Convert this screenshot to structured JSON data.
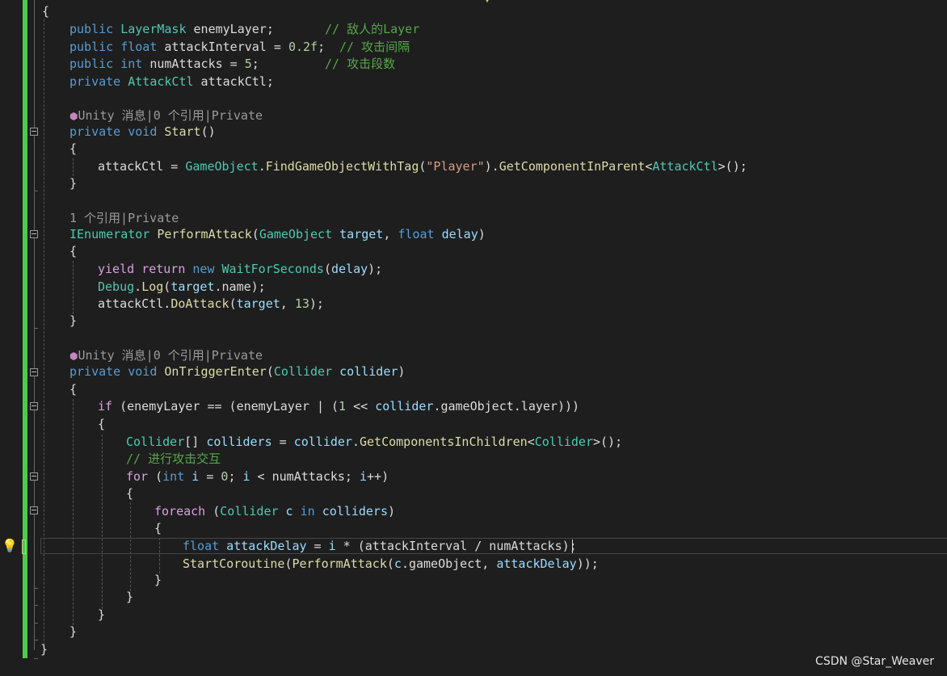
{
  "codelens": {
    "start": "Unity 消息|0 个引用|Private",
    "perform_attack": "1 个引用|Private",
    "on_trigger_enter": "Unity 消息|0 个引用|Private"
  },
  "code": {
    "open_class": "{",
    "f1": {
      "a": "public",
      "t": "LayerMask",
      "n": " enemyLayer;",
      "c": "// 敌人的Layer"
    },
    "f2": {
      "a": "public",
      "t": "float",
      "n": " attackInterval = ",
      "v": "0.2f",
      "e": ";",
      "c": "// 攻击间隔"
    },
    "f3": {
      "a": "public",
      "t": "int",
      "n": " numAttacks = ",
      "v": "5",
      "e": ";",
      "c": "// 攻击段数"
    },
    "f4": {
      "a": "private",
      "t": "AttackCtl",
      "n": " attackCtl;"
    },
    "start_sig": {
      "a": "private",
      "b": "void",
      "f": "Start",
      "p": "()"
    },
    "start_body": {
      "a": "attackCtl = ",
      "t": "GameObject",
      "d": ".",
      "f": "FindGameObjectWithTag",
      "o": "(",
      "s": "\"Player\"",
      "c": ").",
      "g": "GetComponentInParent",
      "lt": "<",
      "t2": "AttackCtl",
      "end": ">();"
    },
    "perform_sig": {
      "t": "IEnumerator",
      "f": "PerformAttack",
      "o": "(",
      "t2": "GameObject",
      "p1": "target",
      "cm": ", ",
      "k": "float",
      "p2": "delay",
      "c": ")"
    },
    "yield_line": {
      "a": "yield",
      "b": "return",
      "c": "new",
      "t": "WaitForSeconds",
      "o": "(",
      "p": "delay",
      "e": ");"
    },
    "debug_line": {
      "t": "Debug",
      "d": ".",
      "f": "Log",
      "o": "(",
      "p": "target",
      "d2": ".",
      "m": "name",
      "e": ");"
    },
    "doattack_line": {
      "a": "attackCtl.",
      "f": "DoAttack",
      "o": "(",
      "p": "target",
      "cm": ", ",
      "v": "13",
      "e": ");"
    },
    "trigger_sig": {
      "a": "private",
      "b": "void",
      "f": "OnTriggerEnter",
      "o": "(",
      "t": "Collider",
      "p": "collider",
      "c": ")"
    },
    "if_line": {
      "k": "if",
      "a": " (enemyLayer == (enemyLayer ",
      "pipe": "|",
      "b": " (",
      "v": "1",
      "c": " << ",
      "p": "collider",
      "d": ".gameObject.layer)))"
    },
    "colliders_line": {
      "t": "Collider",
      "a": "[] ",
      "v": "colliders",
      "b": " = ",
      "p": "collider",
      "d": ".",
      "f": "GetComponentsInChildren",
      "lt": "<",
      "t2": "Collider",
      "e": ">();"
    },
    "comment_line": "// 进行攻击交互",
    "for_line": {
      "k": "for",
      "a": " (",
      "t": "int",
      "v": " i",
      "b": " = ",
      "n": "0",
      "c": "; ",
      "v2": "i",
      "d": " < numAttacks; ",
      "v3": "i",
      "e": "++)"
    },
    "foreach_line": {
      "k": "foreach",
      "a": " (",
      "t": "Collider",
      "v": " c",
      "i": " in",
      "p": " colliders",
      "e": ")"
    },
    "delay_line": {
      "k": "float",
      "v": " attackDelay",
      "a": " = ",
      "v2": "i",
      "b": " * (attackInterval / numAttacks);"
    },
    "coroutine_line": {
      "f": "StartCoroutine",
      "o": "(",
      "f2": "PerformAttack",
      "o2": "(",
      "p": "c",
      "d": ".gameObject, ",
      "v": "attackDelay",
      "e": "));"
    },
    "brace_open": "{",
    "brace_close": "}"
  },
  "watermark": "CSDN @Star_Weaver",
  "colors": {
    "background": "#1e1e1e",
    "keyword": "#569cd6",
    "type": "#4ec9b0",
    "method": "#dcdcaa",
    "string": "#d69d85",
    "comment": "#57a64a",
    "number": "#b5cea8",
    "change-bar": "#4ec94e"
  }
}
